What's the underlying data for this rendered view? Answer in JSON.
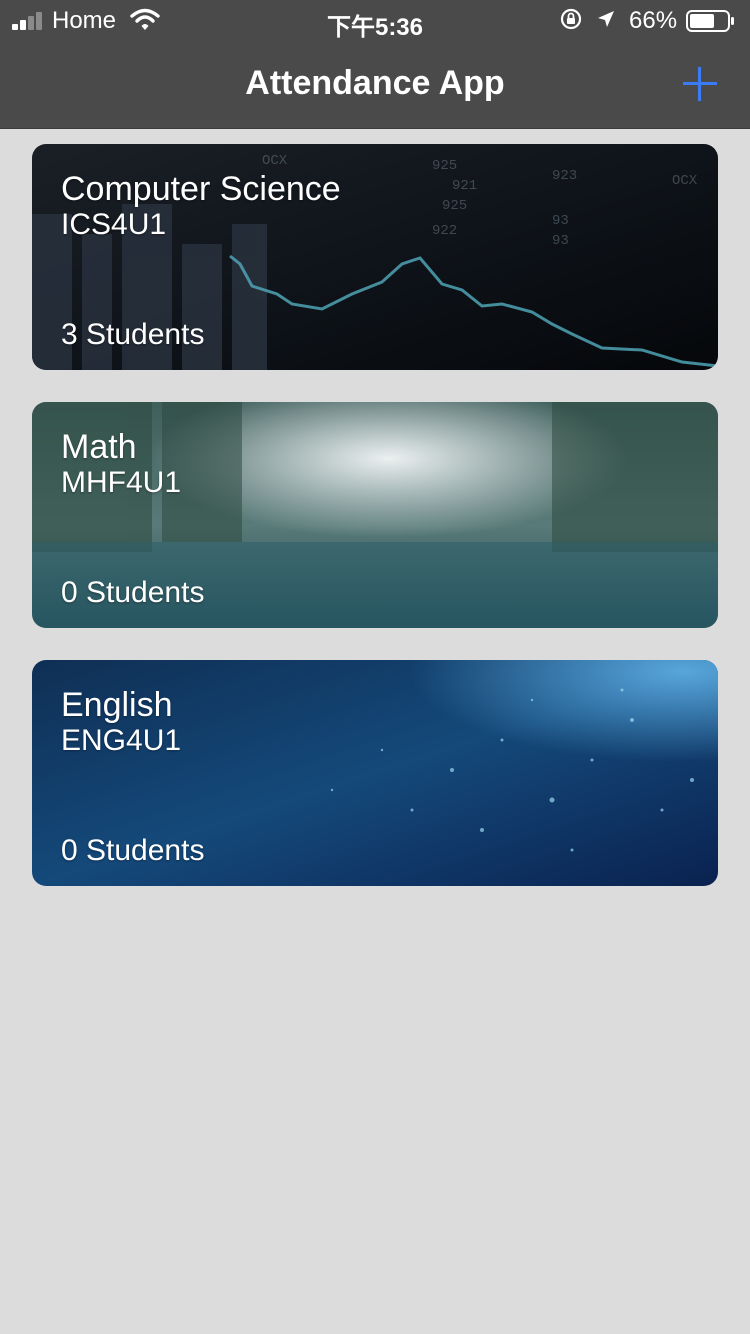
{
  "status_bar": {
    "carrier": "Home",
    "time": "下午5:36",
    "battery_percent": "66%",
    "battery_level": 0.66,
    "icons": [
      "signal-icon",
      "wifi-icon",
      "orientation-lock-icon",
      "location-icon",
      "battery-icon"
    ]
  },
  "nav": {
    "title": "Attendance App",
    "add_icon": "plus-icon"
  },
  "colors": {
    "nav_background": "#4a4a4a",
    "page_background": "#dcdcdc",
    "accent": "#3a7cf5",
    "text": "#ffffff"
  },
  "courses": [
    {
      "name": "Computer Science",
      "code": "ICS4U1",
      "students": "3 Students",
      "background": "stock-market-image"
    },
    {
      "name": "Math",
      "code": "MHF4U1",
      "students": "0 Students",
      "background": "rainy-city-street-image"
    },
    {
      "name": "English",
      "code": "ENG4U1",
      "students": "0 Students",
      "background": "blue-particles-image"
    }
  ]
}
